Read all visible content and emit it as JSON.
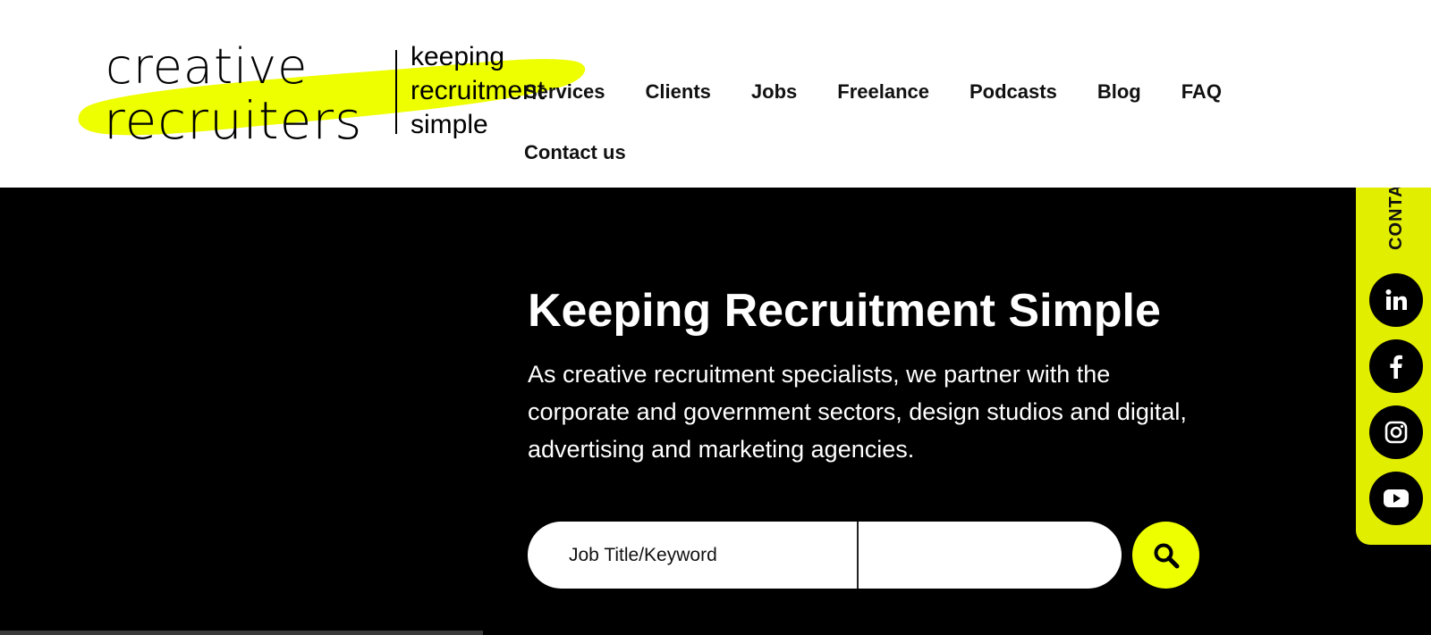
{
  "logo": {
    "line1": "creative",
    "line2": "recruiters",
    "tagline": [
      "keeping",
      "recruitment",
      "simple"
    ],
    "highlight_color": "#eeff00"
  },
  "nav": {
    "items": [
      {
        "label": "Services"
      },
      {
        "label": "Clients"
      },
      {
        "label": "Jobs"
      },
      {
        "label": "Freelance"
      },
      {
        "label": "Podcasts"
      },
      {
        "label": "Blog"
      },
      {
        "label": "FAQ"
      },
      {
        "label": "Contact us"
      }
    ]
  },
  "hero": {
    "title": "Keeping Recruitment Simple",
    "text": "As creative recruitment specialists, we partner with the corporate and government sectors, design studios and digital, advertising and marketing agencies."
  },
  "search": {
    "keyword_placeholder": "Job Title/Keyword",
    "location_placeholder": "",
    "button_icon": "search-icon",
    "button_color": "#eeff00"
  },
  "side_panel": {
    "contact_label": "CONTACT",
    "socials": [
      {
        "icon": "linkedin-icon",
        "label": "in"
      },
      {
        "icon": "facebook-icon",
        "label": "f"
      },
      {
        "icon": "instagram-icon"
      },
      {
        "icon": "youtube-icon"
      }
    ],
    "background": "#e2ee00"
  }
}
